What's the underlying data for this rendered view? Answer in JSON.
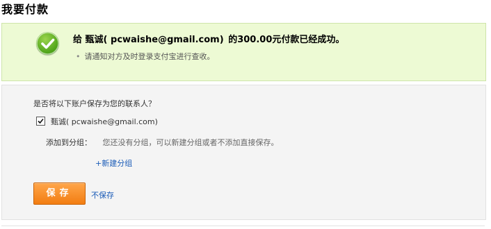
{
  "page": {
    "title": "我要付款"
  },
  "success": {
    "prefix": "给",
    "payee": "甄诚( pcwaishe@gmail.com)",
    "amount_phrase": "的300.00元付款已经成功。",
    "notice": "请通知对方及时登录支付宝进行查收。"
  },
  "contact": {
    "question": "是否将以下账户保存为您的联系人？",
    "checkbox_checked": true,
    "contact_label": "甄诚( pcwaishe@gmail.com)",
    "group_label": "添加到分组：",
    "group_hint": "您还没有分组，可以新建分组或者不添加直接保存。",
    "new_group_link": "+新建分组",
    "save_button": "保存",
    "dont_save_link": "不保存"
  },
  "colors": {
    "success_bg": "#edfad4",
    "accent_orange": "#f27d12",
    "link_blue": "#1a5bb7",
    "check_green": "#55a81d"
  },
  "icons": [
    "check-circle-icon",
    "checkbox-checked-icon",
    "bullet-icon"
  ]
}
